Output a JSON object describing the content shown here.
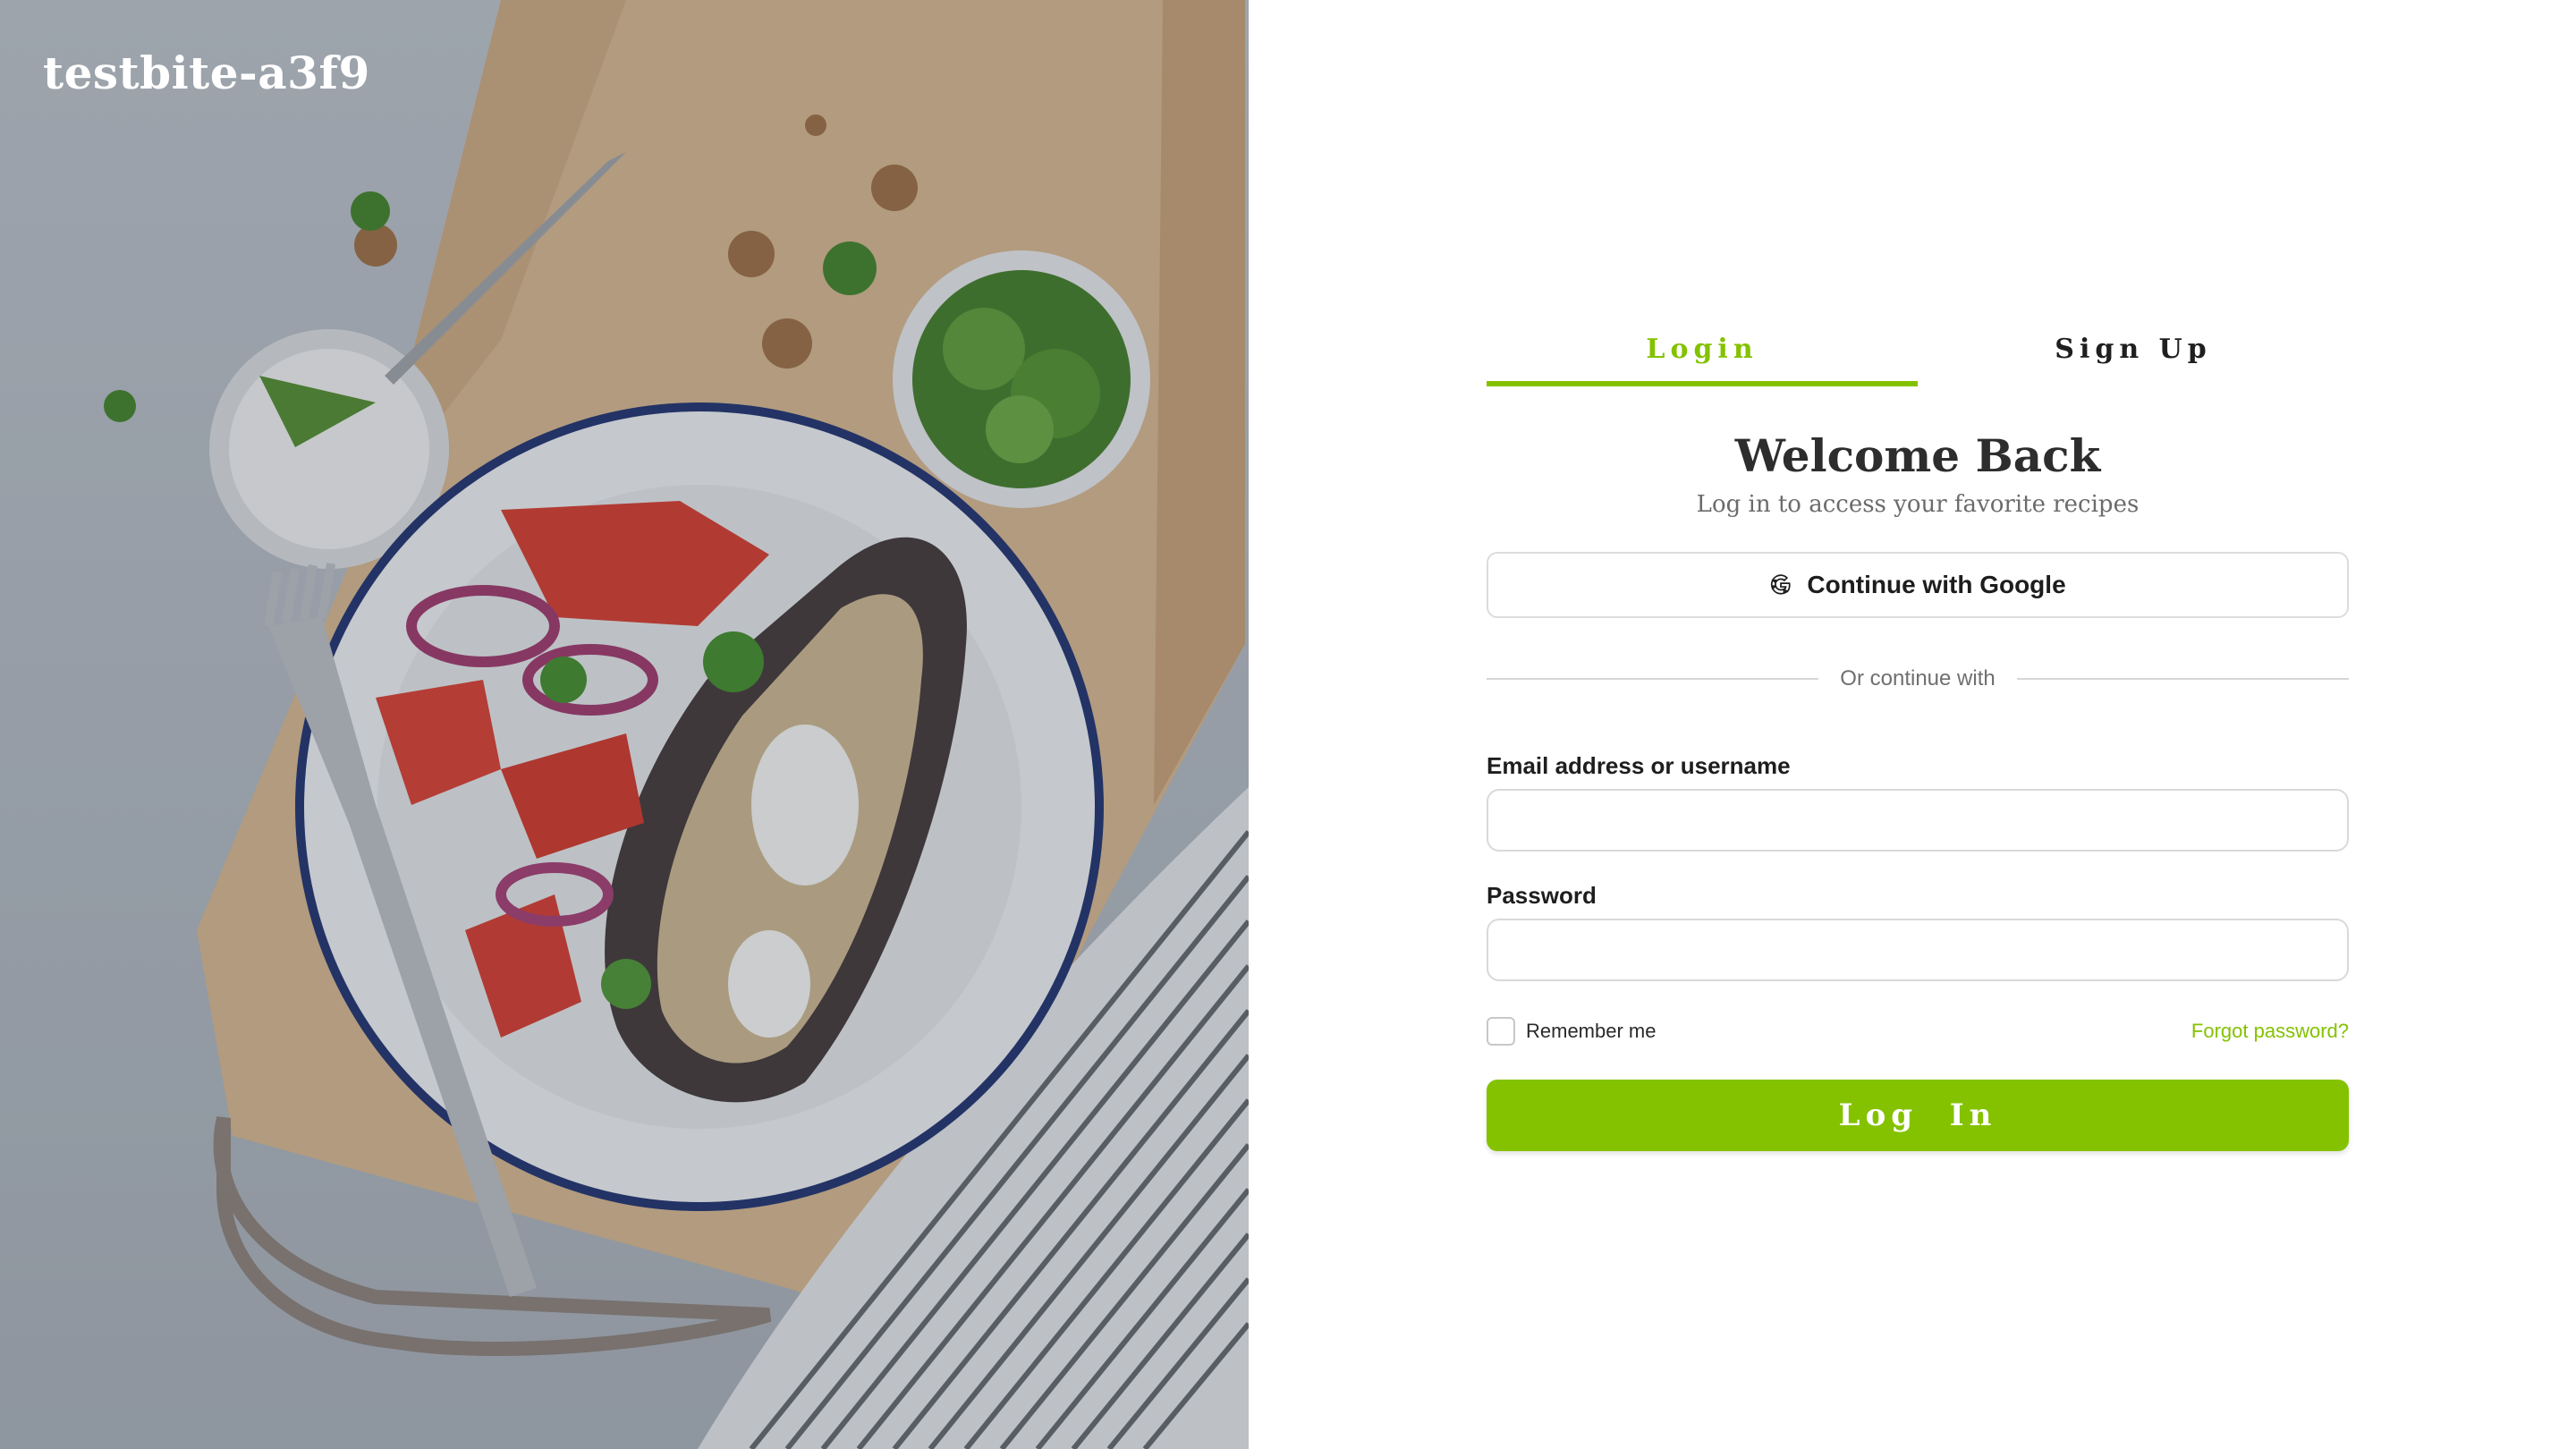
{
  "brand": {
    "name": "testbite-a3f9"
  },
  "hero": {
    "image_alt": "Roasted eggplant with quinoa, tomato and onion salad on a plate"
  },
  "tabs": [
    {
      "label": "Login",
      "active": true
    },
    {
      "label": "Sign Up",
      "active": false
    }
  ],
  "form": {
    "title": "Welcome Back",
    "subtitle": "Log in to access your favorite recipes",
    "google_button": "Continue with Google",
    "divider": "Or continue with",
    "email_label": "Email address or username",
    "email_value": "",
    "email_placeholder": "",
    "password_label": "Password",
    "password_value": "",
    "password_placeholder": "",
    "remember_label": "Remember me",
    "remember_checked": false,
    "forgot_link": "Forgot password?",
    "submit": "Log  In"
  },
  "icons": {
    "google": "google-g-icon"
  },
  "colors": {
    "accent": "#84c200",
    "text_dark": "#2d2d2d",
    "muted": "#6b6b6b",
    "border": "#d9d9d9"
  }
}
